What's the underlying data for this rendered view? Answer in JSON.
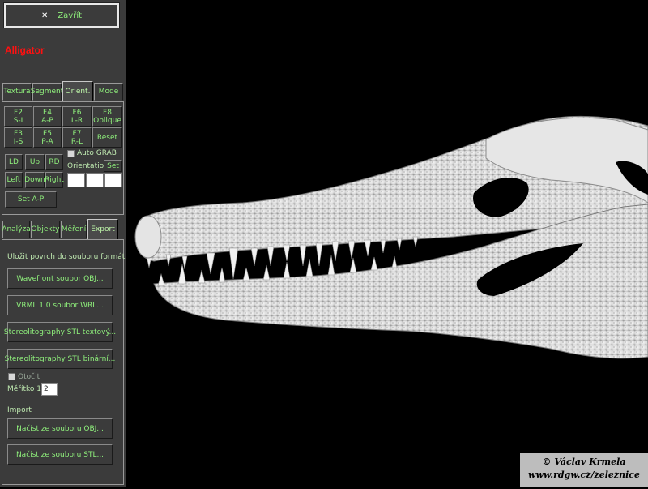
{
  "close_button": {
    "icon": "close-icon",
    "label": "Zavřít"
  },
  "app_title": "Alligator",
  "view_tabs": [
    {
      "label": "Textura"
    },
    {
      "label": "Segment"
    },
    {
      "label": "Orient."
    },
    {
      "label": "Mode"
    }
  ],
  "orient": {
    "keys": [
      {
        "top": "F2",
        "bottom": "S-I"
      },
      {
        "top": "F4",
        "bottom": "A-P"
      },
      {
        "top": "F6",
        "bottom": "L-R"
      },
      {
        "top": "F8",
        "bottom": "Oblique"
      },
      {
        "top": "F3",
        "bottom": "I-S"
      },
      {
        "top": "F5",
        "bottom": "P-A"
      },
      {
        "top": "F7",
        "bottom": "R-L"
      }
    ],
    "reset": "Reset",
    "moves": [
      "LD",
      "Up",
      "RD",
      "Left",
      "Down",
      "Right"
    ],
    "auto_grab": "Auto GRAB",
    "orientation_label": "Orientation:",
    "set": "Set",
    "set_ap": "Set A-P"
  },
  "func_tabs": [
    {
      "label": "Analýza"
    },
    {
      "label": "Objekty"
    },
    {
      "label": "Měření"
    },
    {
      "label": "Export"
    }
  ],
  "export": {
    "heading": "Uložit povrch do souboru formátu:",
    "buttons": [
      "Wavefront soubor OBJ...",
      "VRML 1.0 soubor WRL...",
      "Stereolitography STL textový...",
      "Stereolitography STL binární..."
    ],
    "rotate_label": "Otočit",
    "scale_label": "Měřítko 1:",
    "scale_value": "2"
  },
  "import": {
    "heading": "Import",
    "buttons": [
      "Načíst ze souboru OBJ...",
      "Načíst ze souboru STL..."
    ]
  },
  "copyright": {
    "line1": "© Václav Krmela",
    "line2": "www.rdgw.cz/zeleznice"
  },
  "colors": {
    "panel": "#3b3b3b",
    "button_text": "#8ff07c",
    "title": "#ff1010",
    "viewport": "#000000"
  }
}
